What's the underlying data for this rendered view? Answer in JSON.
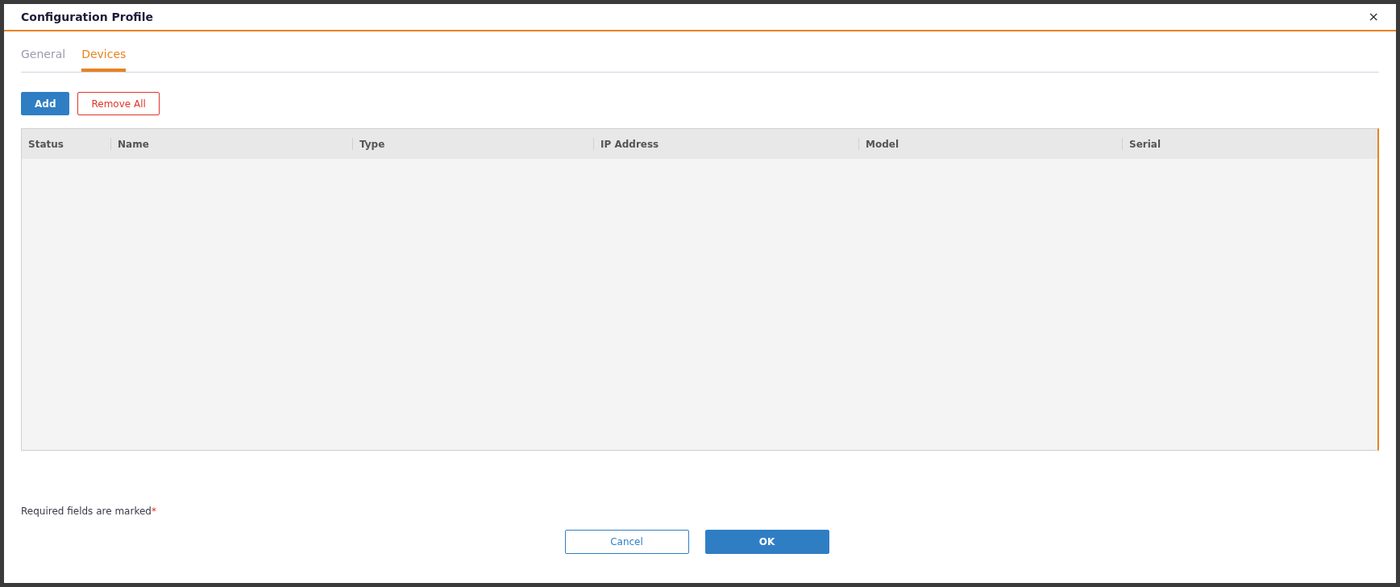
{
  "window": {
    "title": "Configuration Profile",
    "close": "×"
  },
  "tabs": [
    {
      "label": "General",
      "selected": false
    },
    {
      "label": "Devices",
      "selected": true
    }
  ],
  "actions": [
    {
      "label": "Add",
      "kind": "primary"
    },
    {
      "label": "Remove All",
      "kind": "danger"
    }
  ],
  "table": {
    "columns": [
      "Status",
      "Name",
      "Type",
      "IP Address",
      "Model",
      "Serial"
    ]
  },
  "footer": {
    "note": "Required fields are marked",
    "required_mark": "*"
  },
  "buttons": [
    {
      "label": "Cancel",
      "kind": "secondary"
    },
    {
      "label": "OK",
      "kind": "primary"
    }
  ]
}
